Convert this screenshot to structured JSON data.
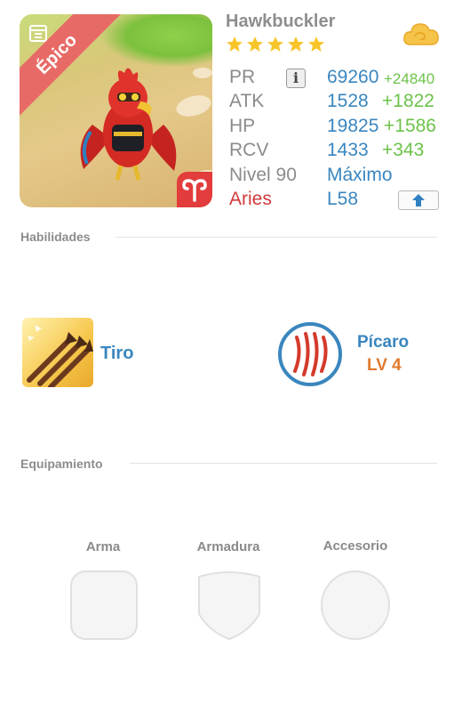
{
  "hero": {
    "name": "Hawkbuckler",
    "rarity": "Épico",
    "stars": 5,
    "sign_icon": "aries-icon"
  },
  "stats": {
    "pr": {
      "label": "PR",
      "value": "69260",
      "bonus": "+24840"
    },
    "atk": {
      "label": "ATK",
      "value": "1528",
      "bonus": "+1822"
    },
    "hp": {
      "label": "HP",
      "value": "19825",
      "bonus": "+1586"
    },
    "rcv": {
      "label": "RCV",
      "value": "1433",
      "bonus": "+343"
    },
    "level": {
      "label": "Nivel 90",
      "value": "Máximo"
    },
    "sign": {
      "label": "Aries",
      "value": "L58"
    }
  },
  "skills": {
    "title": "Habilidades",
    "skill_name": "Tiro",
    "class_name": "Pícaro",
    "class_level": "LV 4"
  },
  "equipment": {
    "title": "Equipamiento",
    "slots": [
      "Arma",
      "Armadura",
      "Accesorio"
    ]
  },
  "colors": {
    "accent_blue": "#3a86bf",
    "bonus_green": "#6cc24a",
    "sign_red": "#d23a3a",
    "rarity_ribbon": "#e86a66",
    "class_level_orange": "#e07a2e"
  }
}
